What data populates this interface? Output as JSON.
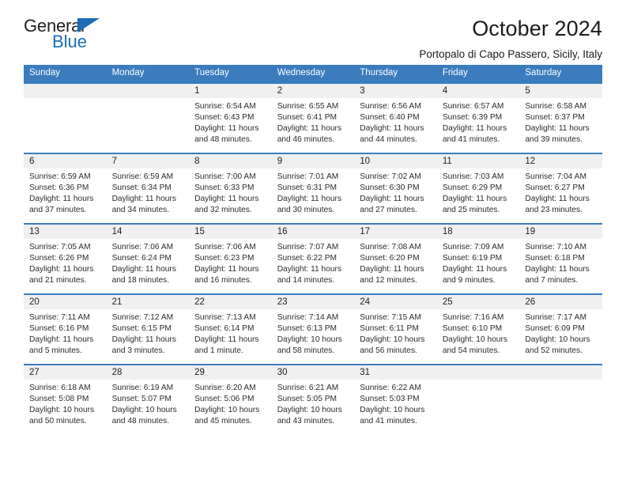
{
  "logo": {
    "word1": "General",
    "word2": "Blue",
    "triangle_color": "#1b6cb5"
  },
  "header": {
    "title": "October 2024",
    "subtitle": "Portopalo di Capo Passero, Sicily, Italy"
  },
  "theme": {
    "header_blue": "#3a7cbe",
    "daynum_grey": "#f0f0f0"
  },
  "labels": {
    "sunrise_prefix": "Sunrise: ",
    "sunset_prefix": "Sunset: ",
    "daylight_prefix": "Daylight: "
  },
  "weekdays": [
    "Sunday",
    "Monday",
    "Tuesday",
    "Wednesday",
    "Thursday",
    "Friday",
    "Saturday"
  ],
  "weeks": [
    [
      {
        "day": "",
        "empty": true
      },
      {
        "day": "",
        "empty": true
      },
      {
        "day": "1",
        "sunrise": "Sunrise: 6:54 AM",
        "sunset": "Sunset: 6:43 PM",
        "daylight": "Daylight: 11 hours and 48 minutes."
      },
      {
        "day": "2",
        "sunrise": "Sunrise: 6:55 AM",
        "sunset": "Sunset: 6:41 PM",
        "daylight": "Daylight: 11 hours and 46 minutes."
      },
      {
        "day": "3",
        "sunrise": "Sunrise: 6:56 AM",
        "sunset": "Sunset: 6:40 PM",
        "daylight": "Daylight: 11 hours and 44 minutes."
      },
      {
        "day": "4",
        "sunrise": "Sunrise: 6:57 AM",
        "sunset": "Sunset: 6:39 PM",
        "daylight": "Daylight: 11 hours and 41 minutes."
      },
      {
        "day": "5",
        "sunrise": "Sunrise: 6:58 AM",
        "sunset": "Sunset: 6:37 PM",
        "daylight": "Daylight: 11 hours and 39 minutes."
      }
    ],
    [
      {
        "day": "6",
        "sunrise": "Sunrise: 6:59 AM",
        "sunset": "Sunset: 6:36 PM",
        "daylight": "Daylight: 11 hours and 37 minutes."
      },
      {
        "day": "7",
        "sunrise": "Sunrise: 6:59 AM",
        "sunset": "Sunset: 6:34 PM",
        "daylight": "Daylight: 11 hours and 34 minutes."
      },
      {
        "day": "8",
        "sunrise": "Sunrise: 7:00 AM",
        "sunset": "Sunset: 6:33 PM",
        "daylight": "Daylight: 11 hours and 32 minutes."
      },
      {
        "day": "9",
        "sunrise": "Sunrise: 7:01 AM",
        "sunset": "Sunset: 6:31 PM",
        "daylight": "Daylight: 11 hours and 30 minutes."
      },
      {
        "day": "10",
        "sunrise": "Sunrise: 7:02 AM",
        "sunset": "Sunset: 6:30 PM",
        "daylight": "Daylight: 11 hours and 27 minutes."
      },
      {
        "day": "11",
        "sunrise": "Sunrise: 7:03 AM",
        "sunset": "Sunset: 6:29 PM",
        "daylight": "Daylight: 11 hours and 25 minutes."
      },
      {
        "day": "12",
        "sunrise": "Sunrise: 7:04 AM",
        "sunset": "Sunset: 6:27 PM",
        "daylight": "Daylight: 11 hours and 23 minutes."
      }
    ],
    [
      {
        "day": "13",
        "sunrise": "Sunrise: 7:05 AM",
        "sunset": "Sunset: 6:26 PM",
        "daylight": "Daylight: 11 hours and 21 minutes."
      },
      {
        "day": "14",
        "sunrise": "Sunrise: 7:06 AM",
        "sunset": "Sunset: 6:24 PM",
        "daylight": "Daylight: 11 hours and 18 minutes."
      },
      {
        "day": "15",
        "sunrise": "Sunrise: 7:06 AM",
        "sunset": "Sunset: 6:23 PM",
        "daylight": "Daylight: 11 hours and 16 minutes."
      },
      {
        "day": "16",
        "sunrise": "Sunrise: 7:07 AM",
        "sunset": "Sunset: 6:22 PM",
        "daylight": "Daylight: 11 hours and 14 minutes."
      },
      {
        "day": "17",
        "sunrise": "Sunrise: 7:08 AM",
        "sunset": "Sunset: 6:20 PM",
        "daylight": "Daylight: 11 hours and 12 minutes."
      },
      {
        "day": "18",
        "sunrise": "Sunrise: 7:09 AM",
        "sunset": "Sunset: 6:19 PM",
        "daylight": "Daylight: 11 hours and 9 minutes."
      },
      {
        "day": "19",
        "sunrise": "Sunrise: 7:10 AM",
        "sunset": "Sunset: 6:18 PM",
        "daylight": "Daylight: 11 hours and 7 minutes."
      }
    ],
    [
      {
        "day": "20",
        "sunrise": "Sunrise: 7:11 AM",
        "sunset": "Sunset: 6:16 PM",
        "daylight": "Daylight: 11 hours and 5 minutes."
      },
      {
        "day": "21",
        "sunrise": "Sunrise: 7:12 AM",
        "sunset": "Sunset: 6:15 PM",
        "daylight": "Daylight: 11 hours and 3 minutes."
      },
      {
        "day": "22",
        "sunrise": "Sunrise: 7:13 AM",
        "sunset": "Sunset: 6:14 PM",
        "daylight": "Daylight: 11 hours and 1 minute."
      },
      {
        "day": "23",
        "sunrise": "Sunrise: 7:14 AM",
        "sunset": "Sunset: 6:13 PM",
        "daylight": "Daylight: 10 hours and 58 minutes."
      },
      {
        "day": "24",
        "sunrise": "Sunrise: 7:15 AM",
        "sunset": "Sunset: 6:11 PM",
        "daylight": "Daylight: 10 hours and 56 minutes."
      },
      {
        "day": "25",
        "sunrise": "Sunrise: 7:16 AM",
        "sunset": "Sunset: 6:10 PM",
        "daylight": "Daylight: 10 hours and 54 minutes."
      },
      {
        "day": "26",
        "sunrise": "Sunrise: 7:17 AM",
        "sunset": "Sunset: 6:09 PM",
        "daylight": "Daylight: 10 hours and 52 minutes."
      }
    ],
    [
      {
        "day": "27",
        "sunrise": "Sunrise: 6:18 AM",
        "sunset": "Sunset: 5:08 PM",
        "daylight": "Daylight: 10 hours and 50 minutes."
      },
      {
        "day": "28",
        "sunrise": "Sunrise: 6:19 AM",
        "sunset": "Sunset: 5:07 PM",
        "daylight": "Daylight: 10 hours and 48 minutes."
      },
      {
        "day": "29",
        "sunrise": "Sunrise: 6:20 AM",
        "sunset": "Sunset: 5:06 PM",
        "daylight": "Daylight: 10 hours and 45 minutes."
      },
      {
        "day": "30",
        "sunrise": "Sunrise: 6:21 AM",
        "sunset": "Sunset: 5:05 PM",
        "daylight": "Daylight: 10 hours and 43 minutes."
      },
      {
        "day": "31",
        "sunrise": "Sunrise: 6:22 AM",
        "sunset": "Sunset: 5:03 PM",
        "daylight": "Daylight: 10 hours and 41 minutes."
      },
      {
        "day": "",
        "empty": true
      },
      {
        "day": "",
        "empty": true
      }
    ]
  ]
}
